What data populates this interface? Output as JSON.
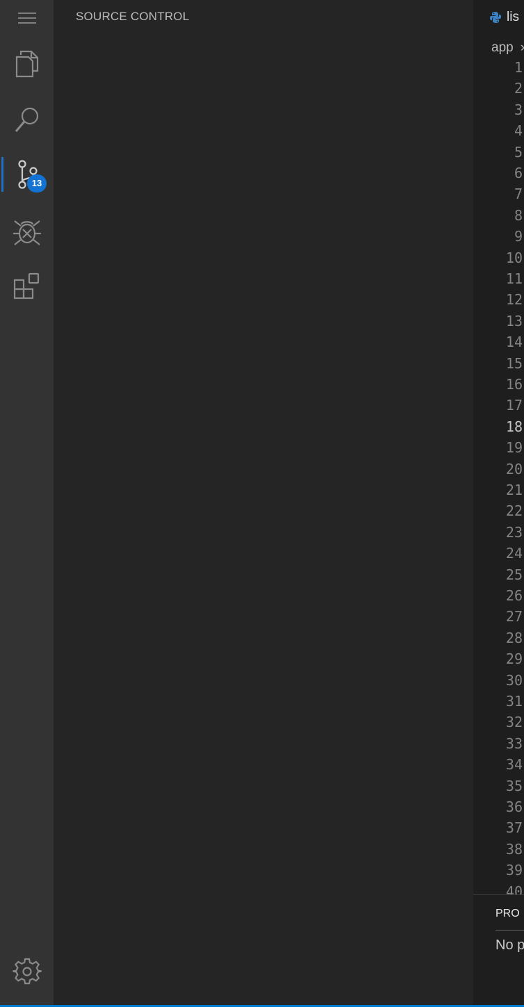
{
  "activity_bar": {
    "items": [
      {
        "name": "menu",
        "icon": "hamburger-menu-icon"
      },
      {
        "name": "explorer",
        "icon": "files-icon"
      },
      {
        "name": "search",
        "icon": "search-icon"
      },
      {
        "name": "source-control",
        "icon": "source-control-icon",
        "badge": "13",
        "active": true
      },
      {
        "name": "run-debug",
        "icon": "debug-icon"
      },
      {
        "name": "extensions",
        "icon": "extensions-icon"
      },
      {
        "name": "settings",
        "icon": "gear-icon"
      }
    ],
    "accent_color": "#1f6fc5",
    "badge_color": "#1273d3"
  },
  "sidebar": {
    "title": "SOURCE CONTROL"
  },
  "editor": {
    "tab": {
      "label": "lis",
      "icon": "python-icon"
    },
    "breadcrumb": {
      "first": "app",
      "separator": "›"
    },
    "current_line": 18,
    "line_numbers": [
      "1",
      "2",
      "3",
      "4",
      "5",
      "6",
      "7",
      "8",
      "9",
      "10",
      "11",
      "12",
      "13",
      "14",
      "15",
      "16",
      "17",
      "18",
      "19",
      "20",
      "21",
      "22",
      "23",
      "24",
      "25",
      "26",
      "27",
      "28",
      "29",
      "30",
      "31",
      "32",
      "33",
      "34",
      "35",
      "36",
      "37",
      "38",
      "39",
      "40"
    ]
  },
  "panel": {
    "tab_label": "PRO",
    "message": "No p"
  },
  "status_bar": {
    "color": "#007acc"
  }
}
